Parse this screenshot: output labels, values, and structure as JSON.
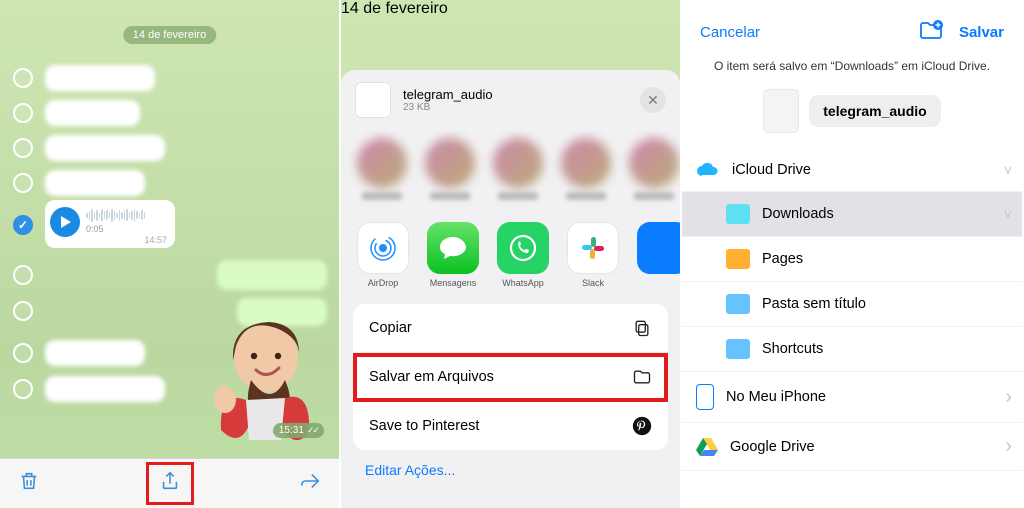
{
  "panel1": {
    "date_label": "14 de fevereiro",
    "voice_duration": "0:05",
    "voice_time": "14:57",
    "sent_time": "15:31"
  },
  "panel2": {
    "date_label": "14 de fevereiro",
    "file_name": "telegram_audio",
    "file_size": "23 KB",
    "apps": {
      "airdrop": "AirDrop",
      "messages": "Mensagens",
      "whatsapp": "WhatsApp",
      "slack": "Slack"
    },
    "actions": {
      "copy": "Copiar",
      "save_files": "Salvar em Arquivos",
      "pinterest": "Save to Pinterest"
    },
    "edit_actions": "Editar Ações..."
  },
  "panel3": {
    "cancel": "Cancelar",
    "save": "Salvar",
    "description": "O item será salvo em “Downloads” em iCloud Drive.",
    "file_name": "telegram_audio",
    "locations": {
      "icloud": "iCloud Drive",
      "downloads": "Downloads",
      "pages": "Pages",
      "untitled": "Pasta sem título",
      "shortcuts": "Shortcuts",
      "on_iphone": "No Meu iPhone",
      "google_drive": "Google Drive"
    }
  }
}
